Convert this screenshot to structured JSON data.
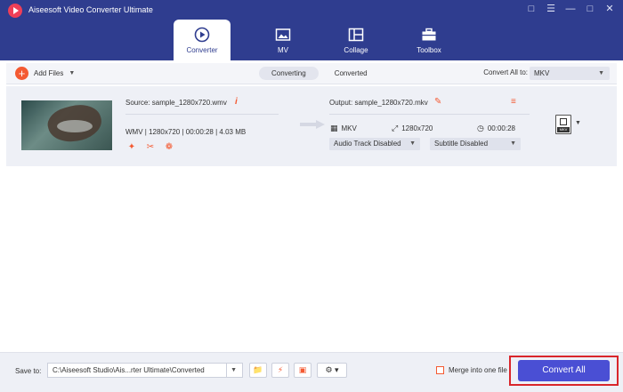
{
  "window": {
    "title": "Aiseesoft Video Converter Ultimate"
  },
  "nav": {
    "tabs": [
      {
        "label": "Converter",
        "icon": "converter-icon",
        "active": true
      },
      {
        "label": "MV",
        "icon": "mv-icon",
        "active": false
      },
      {
        "label": "Collage",
        "icon": "collage-icon",
        "active": false
      },
      {
        "label": "Toolbox",
        "icon": "toolbox-icon",
        "active": false
      }
    ]
  },
  "toolbar": {
    "add_files": "Add Files",
    "converting": "Converting",
    "converted": "Converted",
    "convert_all_to": "Convert All to:",
    "format": "MKV"
  },
  "file": {
    "source_name": "Source: sample_1280x720.wmv",
    "source_meta": "WMV | 1280x720 | 00:00:28 | 4.03 MB",
    "output_name": "Output: sample_1280x720.mkv",
    "out_format": "MKV",
    "out_resolution": "1280x720",
    "out_duration": "00:00:28",
    "audio_track": "Audio Track Disabled",
    "subtitle": "Subtitle Disabled",
    "badge": "MKV"
  },
  "bottom": {
    "save_to": "Save to:",
    "path": "C:\\Aiseesoft Studio\\Ais...rter Ultimate\\Converted",
    "merge": "Merge into one file",
    "convert_all": "Convert All"
  },
  "colors": {
    "header": "#2f3d8f",
    "accent": "#f45a32",
    "button": "#4a4fd4",
    "highlight": "#d9262b"
  }
}
